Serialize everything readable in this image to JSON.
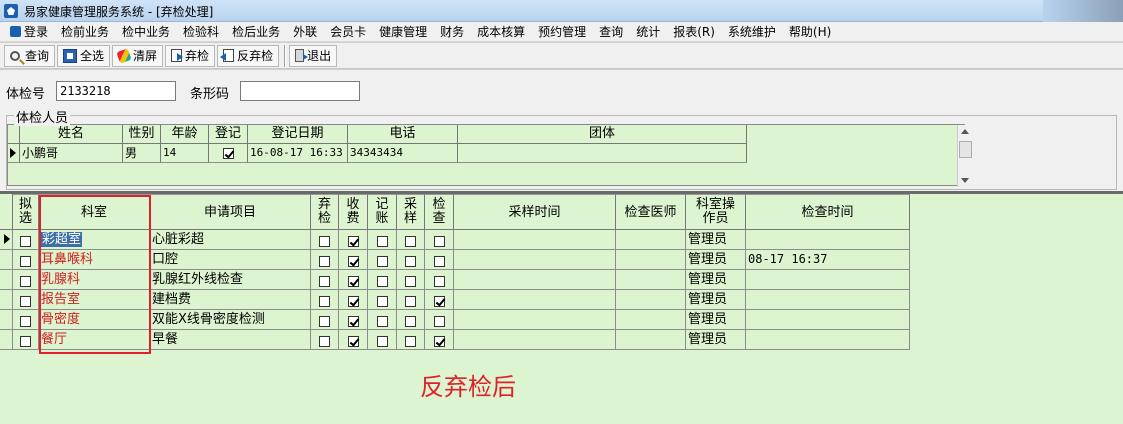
{
  "window": {
    "title": "易家健康管理服务系统 - [弃检处理]"
  },
  "menu": [
    "登录",
    "检前业务",
    "检中业务",
    "检验科",
    "检后业务",
    "外联",
    "会员卡",
    "健康管理",
    "财务",
    "成本核算",
    "预约管理",
    "查询",
    "统计",
    "报表(R)",
    "系统维护",
    "帮助(H)"
  ],
  "toolbar": {
    "query": "查询",
    "select_all": "全选",
    "clear": "清屏",
    "discard": "弃检",
    "undo_discard": "反弃检",
    "exit": "退出"
  },
  "form": {
    "exam_no_label": "体检号",
    "exam_no_value": "2133218",
    "barcode_label": "条形码",
    "barcode_value": "",
    "group_title": "体检人员"
  },
  "persons": {
    "headers": [
      "姓名",
      "性别",
      "年龄",
      "登记",
      "登记日期",
      "电话",
      "团体"
    ],
    "rows": [
      {
        "name": "小鹏哥",
        "sex": "男",
        "age": "14",
        "registered": true,
        "date": "16-08-17 16:33",
        "phone": "34343434",
        "group": ""
      }
    ]
  },
  "items": {
    "headers": {
      "select": [
        "拟",
        "选"
      ],
      "dept": "科室",
      "item": "申请项目",
      "discard": [
        "弃",
        "检"
      ],
      "fee": [
        "收",
        "费"
      ],
      "account": [
        "记",
        "账"
      ],
      "sample": [
        "采",
        "样"
      ],
      "check": [
        "检",
        "查"
      ],
      "sample_time": "采样时间",
      "doctor": "检查医师",
      "operator": [
        "科室操",
        "作员"
      ],
      "check_time": "检查时间"
    },
    "rows": [
      {
        "select": false,
        "dept": "彩超室",
        "item": "心脏彩超",
        "discard": false,
        "fee": true,
        "account": false,
        "sample": false,
        "check": false,
        "sample_time": "",
        "doctor": "",
        "operator": "管理员",
        "check_time": ""
      },
      {
        "select": false,
        "dept": "耳鼻喉科",
        "item": "口腔",
        "discard": false,
        "fee": true,
        "account": false,
        "sample": false,
        "check": false,
        "sample_time": "",
        "doctor": "",
        "operator": "管理员",
        "check_time": "08-17 16:37"
      },
      {
        "select": false,
        "dept": "乳腺科",
        "item": "乳腺红外线检查",
        "discard": false,
        "fee": true,
        "account": false,
        "sample": false,
        "check": false,
        "sample_time": "",
        "doctor": "",
        "operator": "管理员",
        "check_time": ""
      },
      {
        "select": false,
        "dept": "报告室",
        "item": "建档费",
        "discard": false,
        "fee": true,
        "account": false,
        "sample": false,
        "check": true,
        "sample_time": "",
        "doctor": "",
        "operator": "管理员",
        "check_time": ""
      },
      {
        "select": false,
        "dept": "骨密度",
        "item": "双能X线骨密度检测",
        "discard": false,
        "fee": true,
        "account": false,
        "sample": false,
        "check": false,
        "sample_time": "",
        "doctor": "",
        "operator": "管理员",
        "check_time": ""
      },
      {
        "select": false,
        "dept": "餐厅",
        "item": "早餐",
        "discard": false,
        "fee": true,
        "account": false,
        "sample": false,
        "check": true,
        "sample_time": "",
        "doctor": "",
        "operator": "管理员",
        "check_time": ""
      }
    ]
  },
  "annotation": "反弃检后",
  "colors": {
    "grid_bg": "#dcf4cf",
    "annotation": "#e0202a",
    "dept_text": "#d02020",
    "selection": "#3a6ea5"
  }
}
